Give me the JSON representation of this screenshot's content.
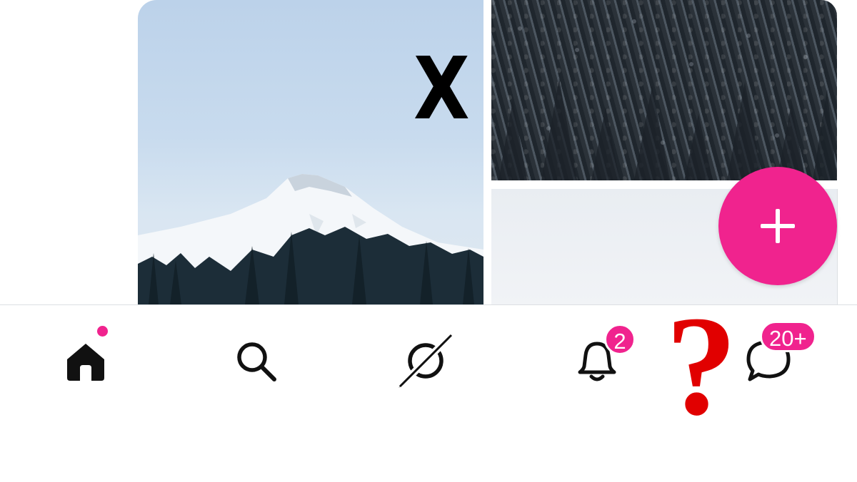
{
  "overlay": {
    "x_mark": "X",
    "question_mark": "?"
  },
  "fab": {
    "icon": "plus-icon"
  },
  "nav": {
    "items": [
      {
        "name": "home",
        "icon": "home-icon",
        "active": true,
        "has_dot": true
      },
      {
        "name": "search",
        "icon": "search-icon"
      },
      {
        "name": "discover",
        "icon": "discover-icon"
      },
      {
        "name": "notifications",
        "icon": "bell-icon",
        "badge": "2"
      },
      {
        "name": "messages",
        "icon": "chat-bubble-icon",
        "badge": "20+"
      }
    ]
  },
  "colors": {
    "accent": "#f0238e",
    "icon": "#111111",
    "overlay_red": "#e10000"
  }
}
